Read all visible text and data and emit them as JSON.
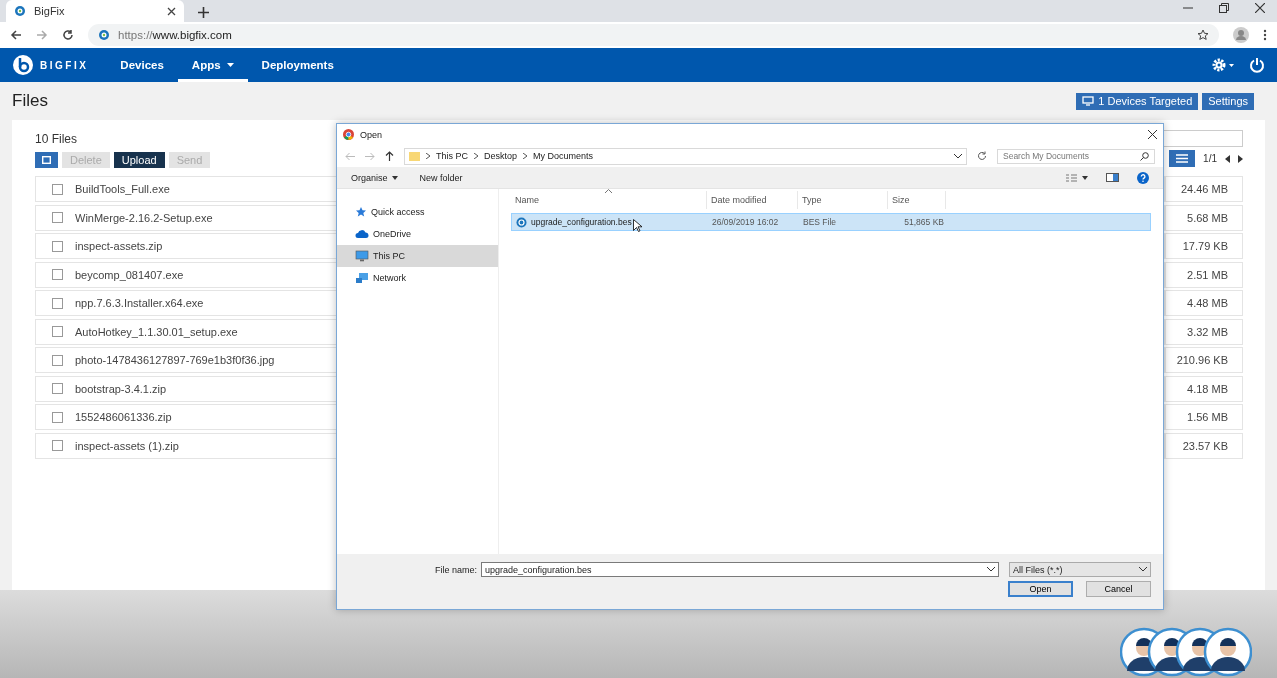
{
  "browser": {
    "tab_title": "BigFix",
    "url_scheme": "https://",
    "url_host": "www.bigfix.com"
  },
  "nav": {
    "brand": "BIGFIX",
    "items": [
      {
        "label": "Devices",
        "selected": false,
        "dropdown": false
      },
      {
        "label": "Apps",
        "selected": true,
        "dropdown": true
      },
      {
        "label": "Deployments",
        "selected": false,
        "dropdown": false
      }
    ]
  },
  "page": {
    "title": "Files",
    "targeted": "1 Devices Targeted",
    "settings": "Settings"
  },
  "files": {
    "count": "10 Files",
    "actions": [
      {
        "label": "Delete",
        "disabled": true
      },
      {
        "label": "Upload",
        "disabled": false
      },
      {
        "label": "Send",
        "disabled": true
      }
    ],
    "pagination": "1/1",
    "rows": [
      {
        "name": "BuildTools_Full.exe",
        "size": "24.46 MB",
        "checked": false
      },
      {
        "name": "WinMerge-2.16.2-Setup.exe",
        "size": "5.68 MB",
        "checked": false
      },
      {
        "name": "inspect-assets.zip",
        "size": "17.79 KB",
        "checked": false
      },
      {
        "name": "beycomp_081407.exe",
        "size": "2.51 MB",
        "checked": false
      },
      {
        "name": "npp.7.6.3.Installer.x64.exe",
        "size": "4.48 MB",
        "checked": false
      },
      {
        "name": "AutoHotkey_1.1.30.01_setup.exe",
        "size": "3.32 MB",
        "checked": false
      },
      {
        "name": "photo-1478436127897-769e1b3f0f36.jpg",
        "size": "210.96 KB",
        "checked": false
      },
      {
        "name": "bootstrap-3.4.1.zip",
        "size": "4.18 MB",
        "checked": false
      },
      {
        "name": "1552486061336.zip",
        "size": "1.56 MB",
        "checked": false
      },
      {
        "name": "inspect-assets (1).zip",
        "size": "23.57 KB",
        "checked": false
      }
    ]
  },
  "dialog": {
    "title": "Open",
    "path": [
      "This PC",
      "Desktop",
      "My Documents"
    ],
    "search_placeholder": "Search My Documents",
    "toolbar": [
      {
        "label": "Organise",
        "dropdown": true
      },
      {
        "label": "New folder",
        "dropdown": false
      }
    ],
    "places": [
      {
        "label": "Quick access",
        "kind": "star",
        "selected": false
      },
      {
        "label": "OneDrive",
        "kind": "cloud",
        "selected": false
      },
      {
        "label": "This PC",
        "kind": "pc",
        "selected": true
      },
      {
        "label": "Network",
        "kind": "network",
        "selected": false
      }
    ],
    "columns": [
      "Name",
      "Date modified",
      "Type",
      "Size"
    ],
    "items": [
      {
        "name": "upgrade_configuration.bes",
        "date": "26/09/2019 16:02",
        "type": "BES File",
        "size": "51,865 KB",
        "selected": true
      }
    ],
    "file_name_label": "File name:",
    "file_name": "upgrade_configuration.bes",
    "filter": "All Files (*.*)",
    "buttons": [
      "Open",
      "Cancel"
    ]
  }
}
